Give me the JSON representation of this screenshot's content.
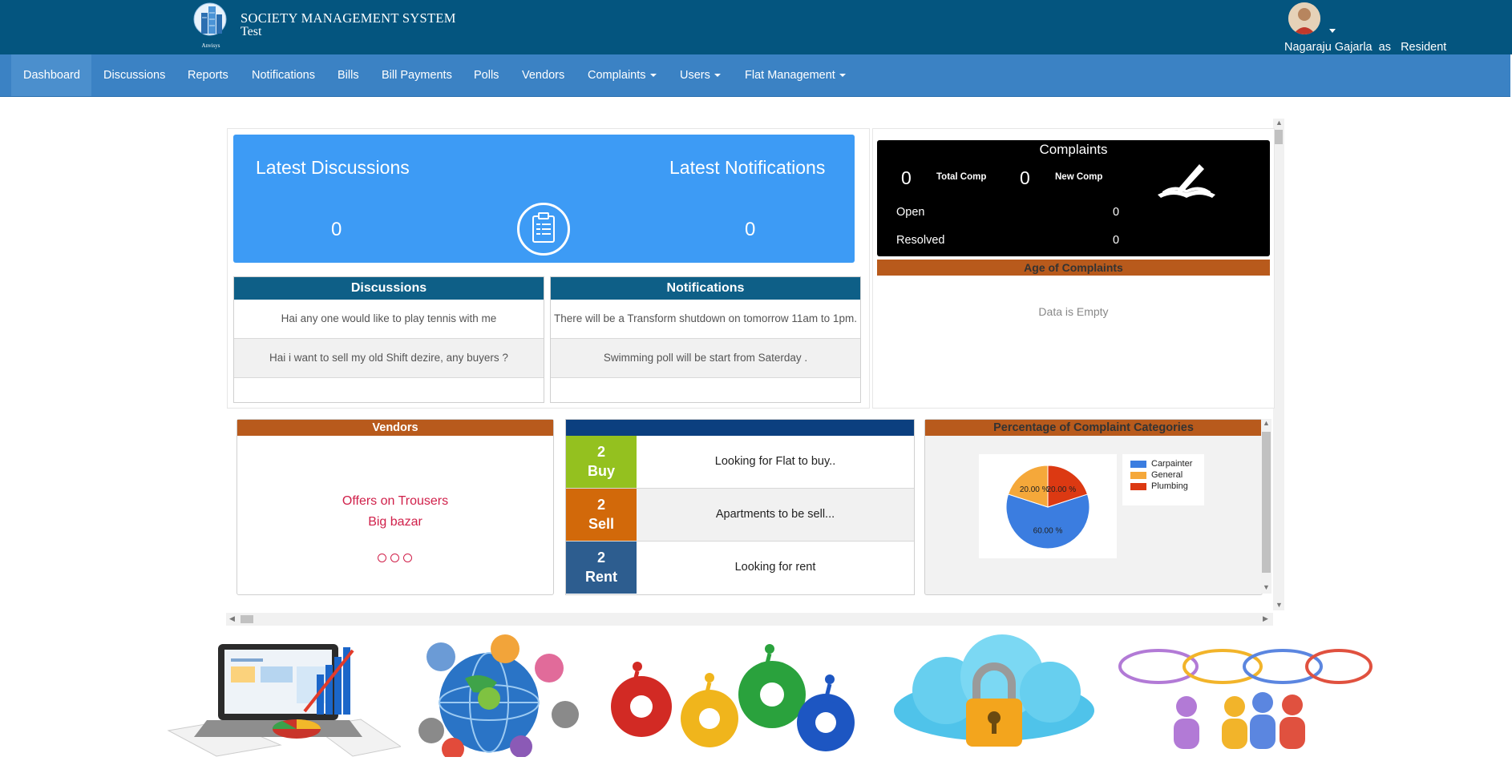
{
  "header": {
    "logo_caption": "Anvisys",
    "app_title": "SOCIETY MANAGEMENT SYSTEM",
    "society_name": "Test",
    "user_line": "Nagaraju Gajarla  as   Resident"
  },
  "nav": {
    "items": [
      {
        "label": "Dashboard",
        "active": true
      },
      {
        "label": "Discussions"
      },
      {
        "label": "Reports"
      },
      {
        "label": "Notifications"
      },
      {
        "label": "Bills"
      },
      {
        "label": "Bill Payments"
      },
      {
        "label": "Polls"
      },
      {
        "label": "Vendors"
      },
      {
        "label": "Complaints",
        "dropdown": true
      },
      {
        "label": "Users",
        "dropdown": true
      },
      {
        "label": "Flat Management",
        "dropdown": true
      }
    ]
  },
  "summary": {
    "discussions_title": "Latest Discussions",
    "discussions_count": "0",
    "notifications_title": "Latest Notifications",
    "notifications_count": "0",
    "icon": "clipboard-icon"
  },
  "discussions": {
    "title": "Discussions",
    "items": [
      "Hai any one would like to play tennis with me",
      "Hai i want to sell my old Shift dezire, any buyers ?"
    ]
  },
  "notifications": {
    "title": "Notifications",
    "items": [
      "There will be a Transform shutdown on tomorrow 11am to 1pm.",
      "Swimming poll will be start from Saterday ."
    ]
  },
  "complaints": {
    "title": "Complaints",
    "total_count": "0",
    "total_label": "Total Comp",
    "new_count": "0",
    "new_label": "New Comp",
    "open_label": "Open",
    "open_count": "0",
    "resolved_label": "Resolved",
    "resolved_count": "0",
    "age_title": "Age of Complaints",
    "age_empty": "Data is Empty"
  },
  "vendors": {
    "title": "Vendors",
    "offer_line": "Offers on Trousers",
    "vendor_name": "Big bazar"
  },
  "ads": {
    "rows": [
      {
        "count": "2",
        "type": "Buy",
        "text": "Looking for Flat to buy..",
        "color": "#94c11f"
      },
      {
        "count": "2",
        "type": "Sell",
        "text": "Apartments to be sell...",
        "color": "#d2690a"
      },
      {
        "count": "2",
        "type": "Rent",
        "text": "Looking for rent",
        "color": "#2d5d8f"
      }
    ]
  },
  "chart_data": {
    "type": "pie",
    "title": "Percentage of Complaint Categories",
    "categories": [
      "Carpainter",
      "General",
      "Plumbing"
    ],
    "values": [
      60,
      20,
      20
    ],
    "labels": [
      "60.00 %",
      "20.00 %",
      "20.00 %"
    ],
    "colors": [
      "#3b7de0",
      "#f5a83a",
      "#dc3912"
    ],
    "legend_position": "right"
  }
}
